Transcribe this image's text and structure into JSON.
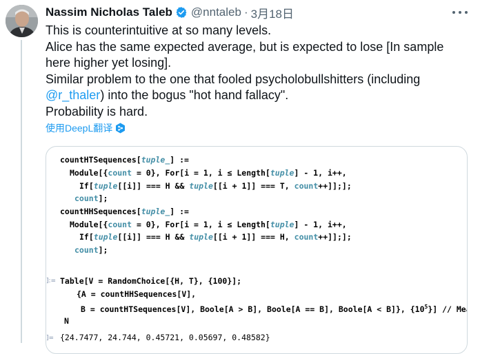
{
  "author": {
    "name": "Nassim Nicholas Taleb",
    "handle": "@nntaleb",
    "separator": "·",
    "date": "3月18日",
    "verified_color": "#1d9bf0"
  },
  "tweet": {
    "lines": [
      "This is counterintuitive at so many levels.",
      "Alice has the same expected average, but is expected to lose [In sample",
      "here higher yet losing].",
      "Similar problem to the one that fooled psycholobullshitters (including",
      "into the bogus \"hot hand fallacy\".",
      "Probability is hard."
    ],
    "mention": "@r_thaler",
    "mention_paren": ")"
  },
  "translate_link": "使用DeepL翻译",
  "code": {
    "def1_head": [
      "countHTSequences[",
      "tuple_",
      "] :="
    ],
    "def1_body1": [
      "Module[{",
      "count",
      " = 0}, For[",
      "i",
      " = 1, ",
      "i",
      " ≤ Length[",
      "tuple",
      "] - 1, ",
      "i",
      "++,"
    ],
    "def1_body2": [
      "If[",
      "tuple",
      "[[",
      "i",
      "]] === H && ",
      "tuple",
      "[[",
      "i",
      " + 1]] === T, ",
      "count",
      "++]];];"
    ],
    "def1_body3": [
      "count",
      "];"
    ],
    "def2_head": [
      "countHHSequences[",
      "tuple_",
      "] :="
    ],
    "def2_body1": [
      "Module[{",
      "count",
      " = 0}, For[",
      "i",
      " = 1, ",
      "i",
      " ≤ Length[",
      "tuple",
      "] - 1, ",
      "i",
      "++,"
    ],
    "def2_body2": [
      "If[",
      "tuple",
      "[[",
      "i",
      "]] === H && ",
      "tuple",
      "[[",
      "i",
      " + 1]] === H, ",
      "count",
      "++]];];"
    ],
    "def2_body3": [
      "count",
      "];"
    ],
    "in_label": "]:=",
    "table_line1": "Table[V = RandomChoice[{H, T}, {100}];",
    "table_line2": "{A = countHHSequences[V],",
    "table_line3_a": "B = countHTSequences[V], Boole[A > B], Boole[A == B], Boole[A < B]}, {10",
    "table_exp": "5",
    "table_line3_b": "}] // Mean //",
    "table_line4": "N",
    "out_label": "]=",
    "output": "{24.7477, 24.744, 0.45721, 0.05697, 0.48582}"
  }
}
